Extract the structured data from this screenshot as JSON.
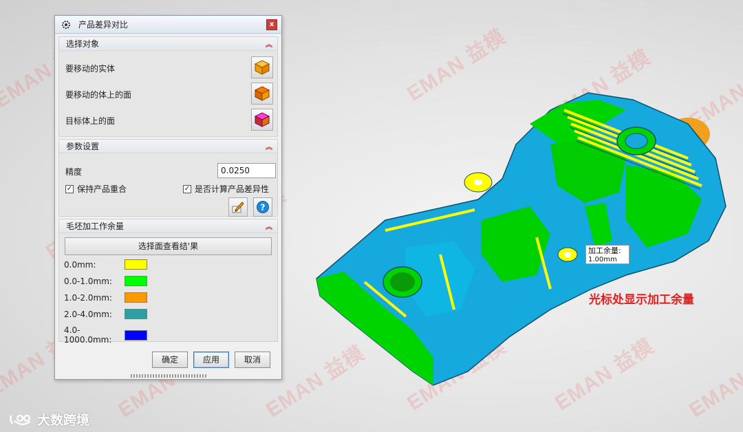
{
  "watermark": "EMAN 益模",
  "dialog": {
    "title": "产品差异对比",
    "close_label": "x",
    "select_section": {
      "header": "选择对象",
      "rows": [
        {
          "label": "要移动的实体",
          "icon": "orange-cube-icon"
        },
        {
          "label": "要移动的体上的面",
          "icon": "orange-face-cube-icon"
        },
        {
          "label": "目标体上的面",
          "icon": "magenta-face-cube-icon"
        }
      ]
    },
    "param_section": {
      "header": "参数设置",
      "precision_label": "精度",
      "precision_value": "0.0250",
      "keep_overlap_label": "保持产品重合",
      "calc_diff_label": "是否计算产品差异性",
      "check_mark": "✓"
    },
    "allowance_section": {
      "header": "毛坯加工作余量",
      "select_face_button": "选择面查看结'果",
      "legend": [
        {
          "label": "0.0mm:",
          "color": "#ffff00"
        },
        {
          "label": "0.0-1.0mm:",
          "color": "#00ff00"
        },
        {
          "label": "1.0-2.0mm:",
          "color": "#ff9900"
        },
        {
          "label": "2.0-4.0mm:",
          "color": "#2e9ea2"
        },
        {
          "label": "4.0-1000.0mm:",
          "color": "#0000ff"
        }
      ]
    },
    "buttons": {
      "ok": "确定",
      "apply": "应用",
      "cancel": "取消"
    }
  },
  "tooltip": {
    "label": "加工余量:",
    "value": "1.00mm"
  },
  "annotation": "光标处显示加工余量",
  "brand": "大数跨境",
  "colors": {
    "model_green": "#00e000",
    "model_cyan": "#19b6e6",
    "model_yellow": "#ffff00",
    "model_orange": "#f2a020"
  }
}
